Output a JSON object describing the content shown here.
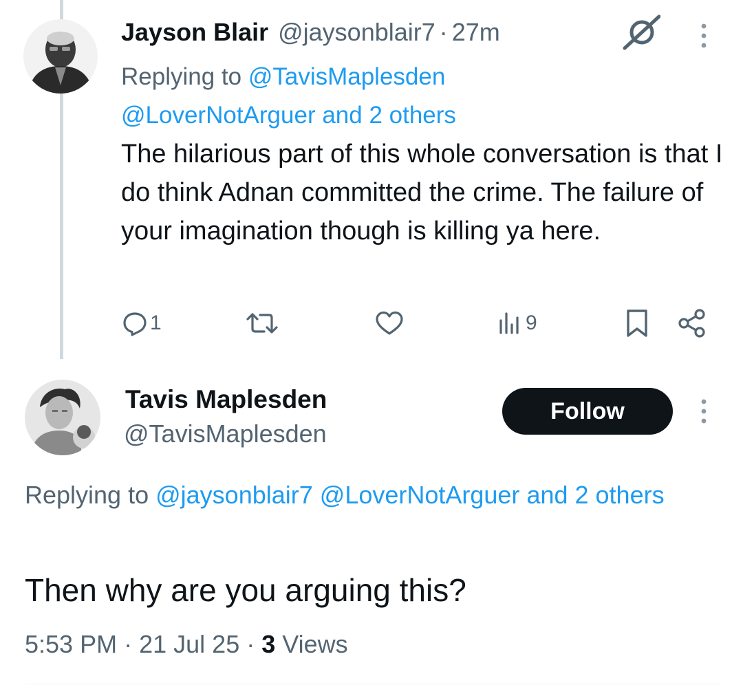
{
  "reply_tweet": {
    "author_name": "Jayson Blair",
    "handle": "@jaysonblair7",
    "separator": "·",
    "time": "27m",
    "replying_prefix": "Replying to ",
    "replying_line1_link": "@TavisMaplesden",
    "replying_line2_link": "@LoverNotArguer and 2 others",
    "body": "The hilarious part of this whole conversation is that I do think Adnan committed the crime. The failure of your imagination though is killing ya here.",
    "reply_count": "1",
    "views_count": "9",
    "icons": {
      "grok": "grok-icon",
      "more": "more-vertical-icon",
      "reply": "reply-icon",
      "retweet": "retweet-icon",
      "like": "heart-icon",
      "views": "views-chart-icon",
      "bookmark": "bookmark-icon",
      "share": "share-icon"
    }
  },
  "main_tweet": {
    "author_name": "Tavis Maplesden",
    "handle": "@TavisMaplesden",
    "follow_label": "Follow",
    "replying_prefix": "Replying to ",
    "replying_link": "@jaysonblair7 @LoverNotArguer and 2 others",
    "body": "Then why are you  arguing this?",
    "time": "5:53 PM",
    "separator": "·",
    "date": "21 Jul 25",
    "views_count": "3",
    "views_label": "Views"
  },
  "colors": {
    "text": "#0f1419",
    "secondary": "#536471",
    "link": "#1d9bf0",
    "thread_line": "#cfd9de",
    "follow_bg": "#0f1419"
  }
}
